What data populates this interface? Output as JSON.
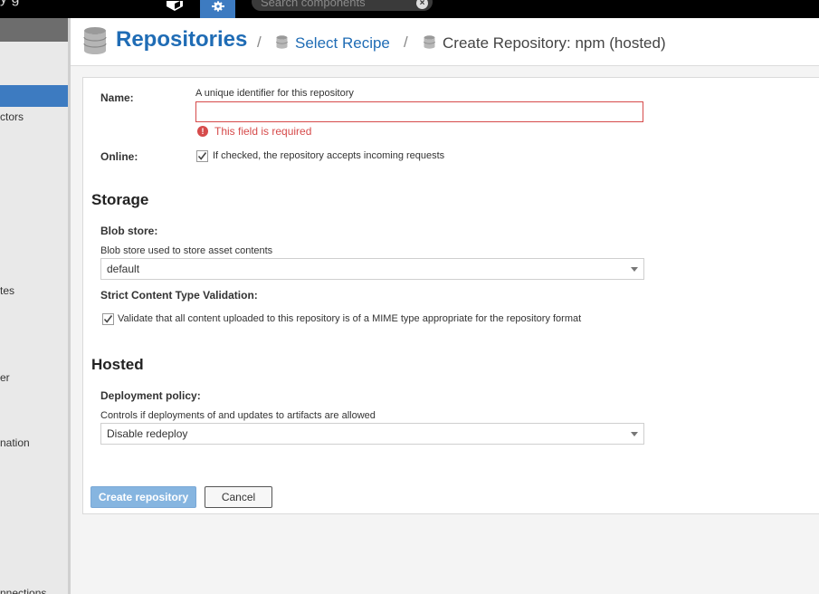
{
  "topbar": {
    "fragment_text": "y  g",
    "search_placeholder": "Search components",
    "admin_color": "#3d7bc1"
  },
  "sidebar": {
    "items": [
      {
        "label": "ctors"
      },
      {
        "label": "tes"
      },
      {
        "label": "er"
      },
      {
        "label": "nation"
      },
      {
        "label": "nnections"
      }
    ]
  },
  "header": {
    "title": "Repositories",
    "crumb_select": "Select Recipe",
    "crumb_current": "Create Repository: npm (hosted)",
    "separator": "/",
    "title_color": "#1f6cb5"
  },
  "form": {
    "name_label": "Name:",
    "name_help": "A unique identifier for this repository",
    "name_value": "",
    "name_error": "This field is required",
    "online_label": "Online:",
    "online_checked": true,
    "online_help": "If checked, the repository accepts incoming requests",
    "storage_title": "Storage",
    "blob_label": "Blob store:",
    "blob_help": "Blob store used to store asset contents",
    "blob_value": "default",
    "strict_label": "Strict Content Type Validation:",
    "strict_checked": true,
    "strict_help": "Validate that all content uploaded to this repository is of a MIME type appropriate for the repository format",
    "hosted_title": "Hosted",
    "deploy_label": "Deployment policy:",
    "deploy_help": "Controls if deployments of and updates to artifacts are allowed",
    "deploy_value": "Disable redeploy",
    "create_button": "Create repository",
    "cancel_button": "Cancel",
    "error_color": "#d64b4b"
  }
}
